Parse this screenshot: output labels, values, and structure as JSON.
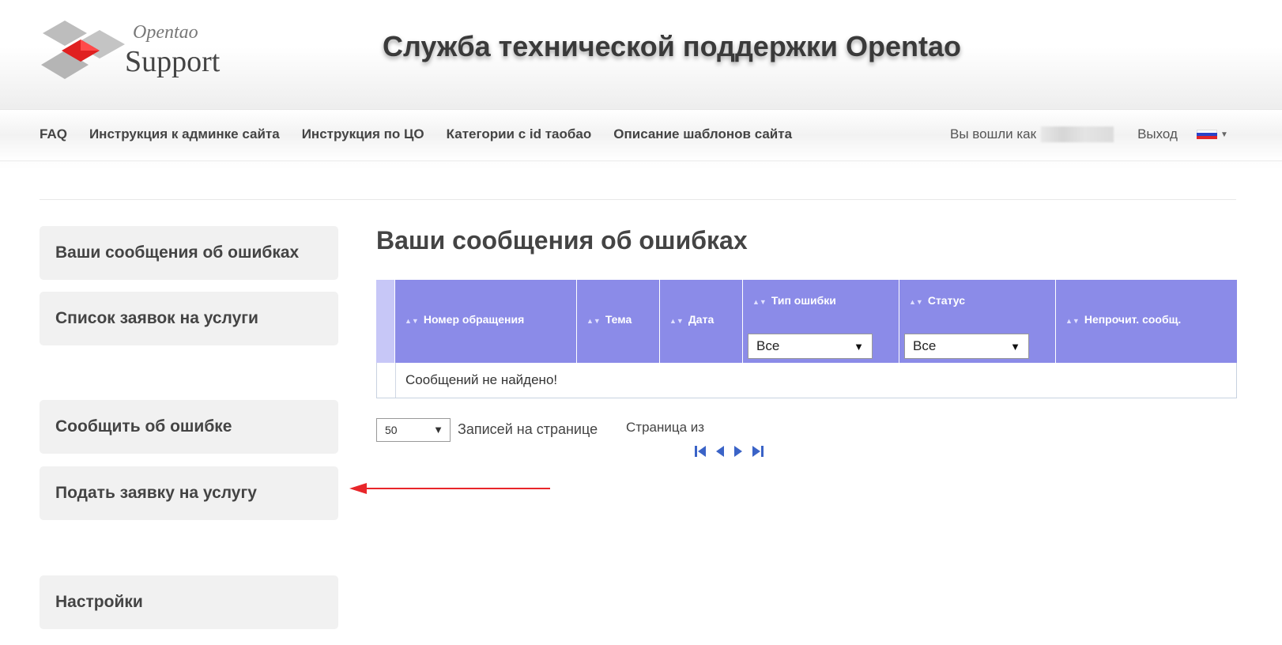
{
  "header": {
    "logo_small": "Opentao",
    "logo_big": "Support",
    "title": "Служба технической поддержки Opentao"
  },
  "nav": {
    "items": [
      {
        "label": "FAQ"
      },
      {
        "label": "Инструкция к админке сайта"
      },
      {
        "label": "Инструкция по ЦО"
      },
      {
        "label": "Категории с id таобао"
      },
      {
        "label": "Описание шаблонов сайта"
      }
    ],
    "logged_in_label": "Вы вошли как",
    "logout_label": "Выход",
    "language_flag": "russia-flag-icon"
  },
  "sidebar": {
    "items": [
      {
        "label": "Ваши сообщения об ошибках"
      },
      {
        "label": "Список заявок на услуги"
      },
      {
        "label": "Сообщить об ошибке"
      },
      {
        "label": "Подать заявку на услугу"
      },
      {
        "label": "Настройки"
      }
    ]
  },
  "main": {
    "title": "Ваши сообщения об ошибках",
    "grid": {
      "columns": [
        {
          "label": "Номер обращения"
        },
        {
          "label": "Тема"
        },
        {
          "label": "Дата"
        },
        {
          "label": "Тип ошибки",
          "filter_value": "Все"
        },
        {
          "label": "Статус",
          "filter_value": "Все"
        },
        {
          "label": "Непрочит. сообщ."
        }
      ],
      "empty_message": "Сообщений не найдено!"
    },
    "pager": {
      "per_page_value": "50",
      "per_page_label": "Записей на странице",
      "page_label": "Страница из"
    }
  },
  "colors": {
    "grid_header": "#8b8be8",
    "grid_header_lead": "#c7c7f7",
    "annotation_arrow": "#e8262a",
    "pager_icons": "#3a63c7"
  }
}
